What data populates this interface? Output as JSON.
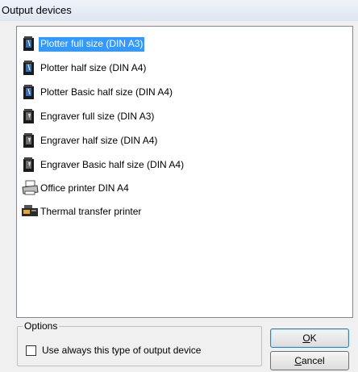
{
  "window": {
    "title": "Output devices"
  },
  "devices": [
    {
      "label": "Plotter full size (DIN A3)",
      "icon": "plotter-icon",
      "selected": true
    },
    {
      "label": "Plotter half size (DIN A4)",
      "icon": "plotter-icon",
      "selected": false
    },
    {
      "label": "Plotter Basic half size (DIN A4)",
      "icon": "plotter-icon",
      "selected": false
    },
    {
      "label": "Engraver full size (DIN A3)",
      "icon": "engraver-icon",
      "selected": false
    },
    {
      "label": "Engraver half size (DIN A4)",
      "icon": "engraver-icon",
      "selected": false
    },
    {
      "label": "Engraver Basic half size (DIN A4)",
      "icon": "engraver-icon",
      "selected": false
    },
    {
      "label": "Office printer DIN A4",
      "icon": "office-printer-icon",
      "selected": false
    },
    {
      "label": "Thermal transfer printer",
      "icon": "thermal-printer-icon",
      "selected": false
    }
  ],
  "options": {
    "legend": "Options",
    "checkbox_label": "Use always this type of output device",
    "checked": false
  },
  "buttons": {
    "ok_mnemonic": "O",
    "ok_rest": "K",
    "cancel_mnemonic": "C",
    "cancel_rest": "ancel"
  },
  "colors": {
    "selection": "#3399ff",
    "dialog_bg": "#f0f0f0"
  }
}
